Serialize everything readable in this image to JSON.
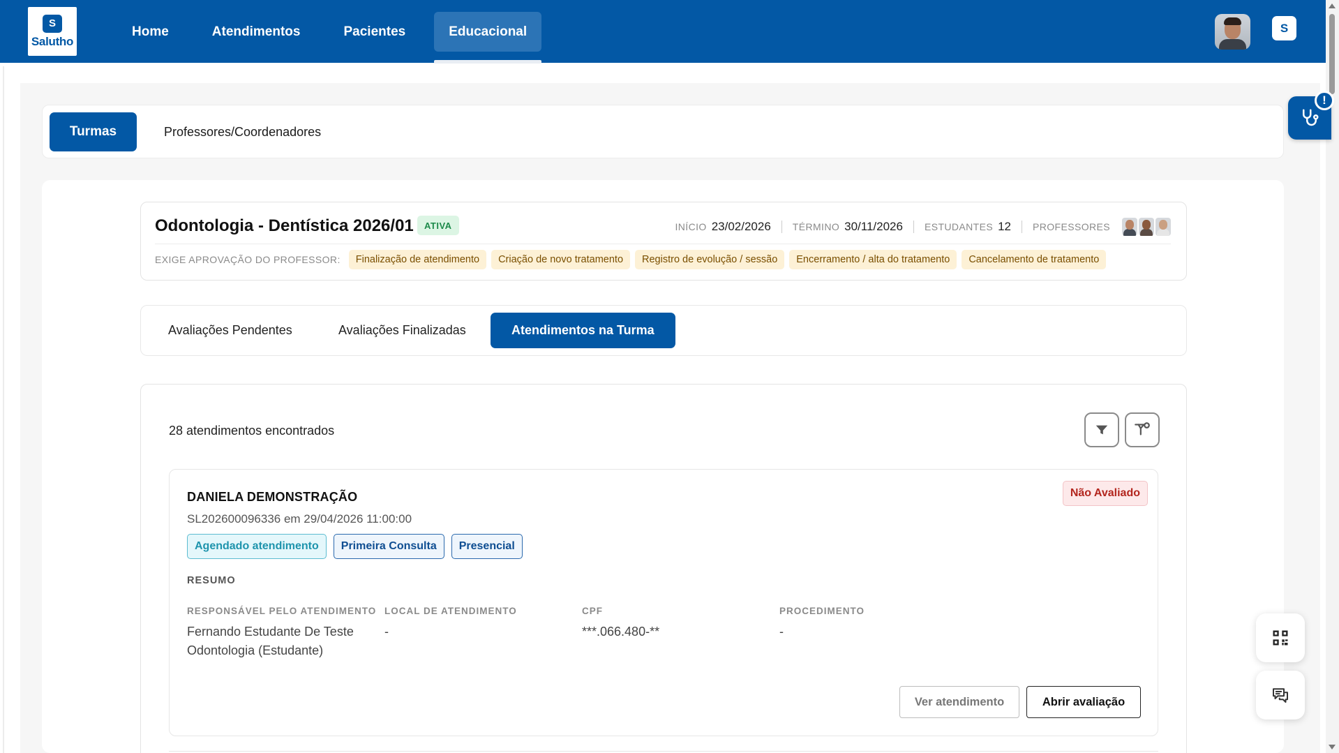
{
  "brand": {
    "name": "Salutho",
    "mark": "S",
    "icon_glyph": "S"
  },
  "nav": {
    "items": [
      {
        "label": "Home"
      },
      {
        "label": "Atendimentos"
      },
      {
        "label": "Pacientes"
      },
      {
        "label": "Educacional"
      }
    ],
    "active": "Educacional"
  },
  "tabs": {
    "turmas": "Turmas",
    "professores": "Professores/Coordenadores"
  },
  "alert_badge": "!",
  "class_info": {
    "title": "Odontologia - Dentística 2026/01",
    "status": "ATIVA",
    "inicio_label": "INÍCIO",
    "inicio": "23/02/2026",
    "termino_label": "TÉRMINO",
    "termino": "30/11/2026",
    "estudantes_label": "ESTUDANTES",
    "estudantes": "12",
    "professores_label": "PROFESSORES",
    "approval_label": "EXIGE APROVAÇÃO DO PROFESSOR:",
    "approvals": [
      "Finalização de atendimento",
      "Criação de novo tratamento",
      "Registro de evolução / sessão",
      "Encerramento / alta do tratamento",
      "Cancelamento de tratamento"
    ]
  },
  "subtabs": {
    "pendentes": "Avaliações Pendentes",
    "finalizadas": "Avaliações Finalizadas",
    "atendimentos": "Atendimentos na Turma"
  },
  "list": {
    "count_text": "28 atendimentos encontrados"
  },
  "appointment": {
    "patient": "DANIELA DEMONSTRAÇÃO",
    "status": "Não Avaliado",
    "code_line": "SL202600096336 em 29/04/2026 11:00:00",
    "tags": [
      "Agendado atendimento",
      "Primeira Consulta",
      "Presencial"
    ],
    "resumo_label": "RESUMO",
    "fields": {
      "responsavel_label": "RESPONSÁVEL PELO ATENDIMENTO",
      "responsavel": "Fernando Estudante De Teste Odontologia (Estudante)",
      "local_label": "LOCAL DE ATENDIMENTO",
      "local": "-",
      "cpf_label": "CPF",
      "cpf": "***.066.480-**",
      "procedimento_label": "PROCEDIMENTO",
      "procedimento": "-"
    },
    "ver_label": "Ver atendimento",
    "abrir_label": "Abrir avaliação"
  },
  "colors": {
    "primary": "#0358a5",
    "status_red": "#b3261e",
    "ativa_green": "#1d8a4a",
    "chip_bg": "#fdf1d6"
  }
}
